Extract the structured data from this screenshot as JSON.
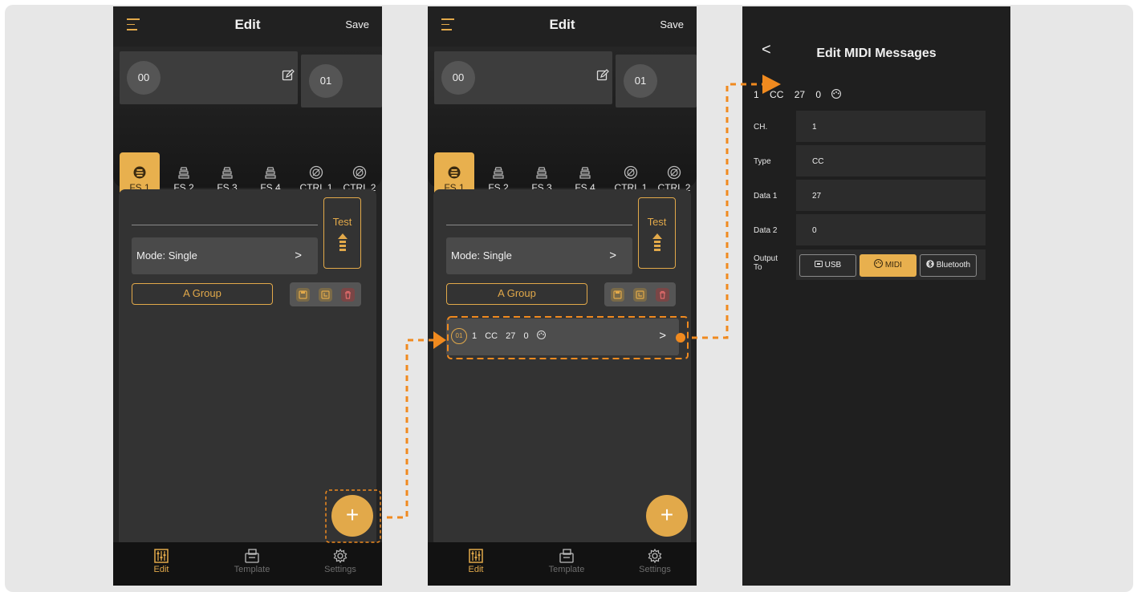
{
  "screens": {
    "edit": {
      "title": "Edit",
      "save_label": "Save",
      "preset_current": "00",
      "preset_next": "01",
      "switches": [
        "FS 1",
        "FS 2",
        "FS 3",
        "FS 4",
        "CTRL 1",
        "CTRL 2"
      ],
      "active_switch": "FS 1",
      "test_label": "Test",
      "mode_label": "Mode: Single",
      "group_label": "A Group",
      "nav": {
        "edit": "Edit",
        "template": "Template",
        "settings": "Settings"
      }
    },
    "message_row": {
      "index": "01",
      "parts": [
        "1",
        "CC",
        "27",
        "0"
      ],
      "output_icon": "midi-din-icon"
    },
    "midi_editor": {
      "title": "Edit MIDI Messages",
      "summary": [
        "1",
        "CC",
        "27",
        "0"
      ],
      "fields": [
        {
          "label": "CH.",
          "value": "1"
        },
        {
          "label": "Type",
          "value": "CC"
        },
        {
          "label": "Data 1",
          "value": "27"
        },
        {
          "label": "Data 2",
          "value": "0"
        }
      ],
      "output_label": "Output\nTo",
      "outputs": [
        "USB",
        "MIDI",
        "Bluetooth"
      ],
      "active_output": "MIDI"
    }
  },
  "colors": {
    "accent": "#e2a94a",
    "arrow": "#f08a1f",
    "background": "#232323",
    "canvas": "#e7e7e7"
  }
}
